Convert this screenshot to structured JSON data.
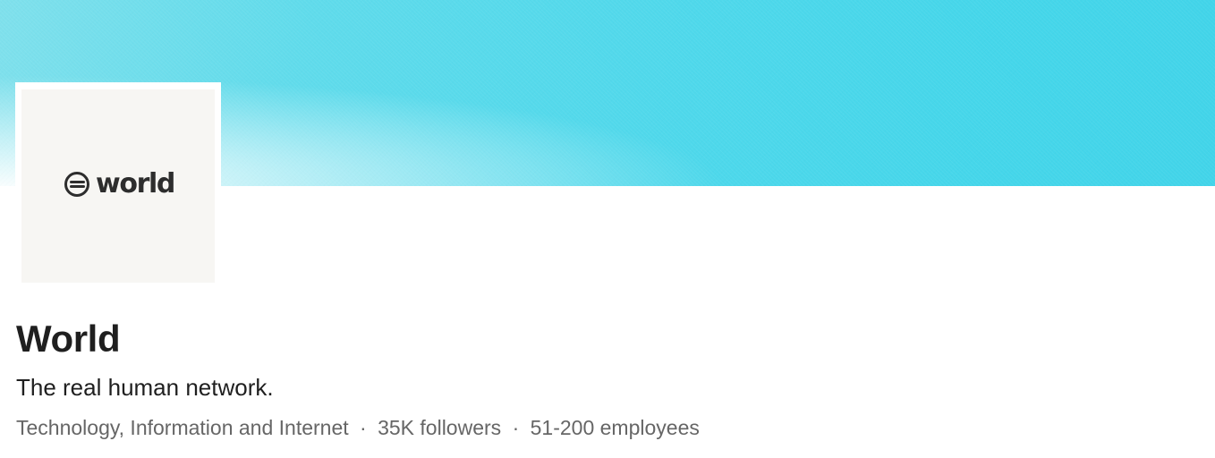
{
  "banner": {
    "gradient_colors": [
      "#7fe0ec",
      "#4fd8eb",
      "#42d4e9"
    ]
  },
  "logo": {
    "icon": "world-e-mark-icon",
    "wordmark": "world"
  },
  "company": {
    "name": "World",
    "tagline": "The real human network.",
    "industry": "Technology, Information and Internet",
    "followers": "35K followers",
    "employees": "51-200 employees",
    "separator": "·"
  },
  "colors": {
    "text_primary": "#1f1f1f",
    "text_secondary": "#666666",
    "logo_background": "#f7f6f3",
    "logo_text": "#2d2d2d"
  }
}
